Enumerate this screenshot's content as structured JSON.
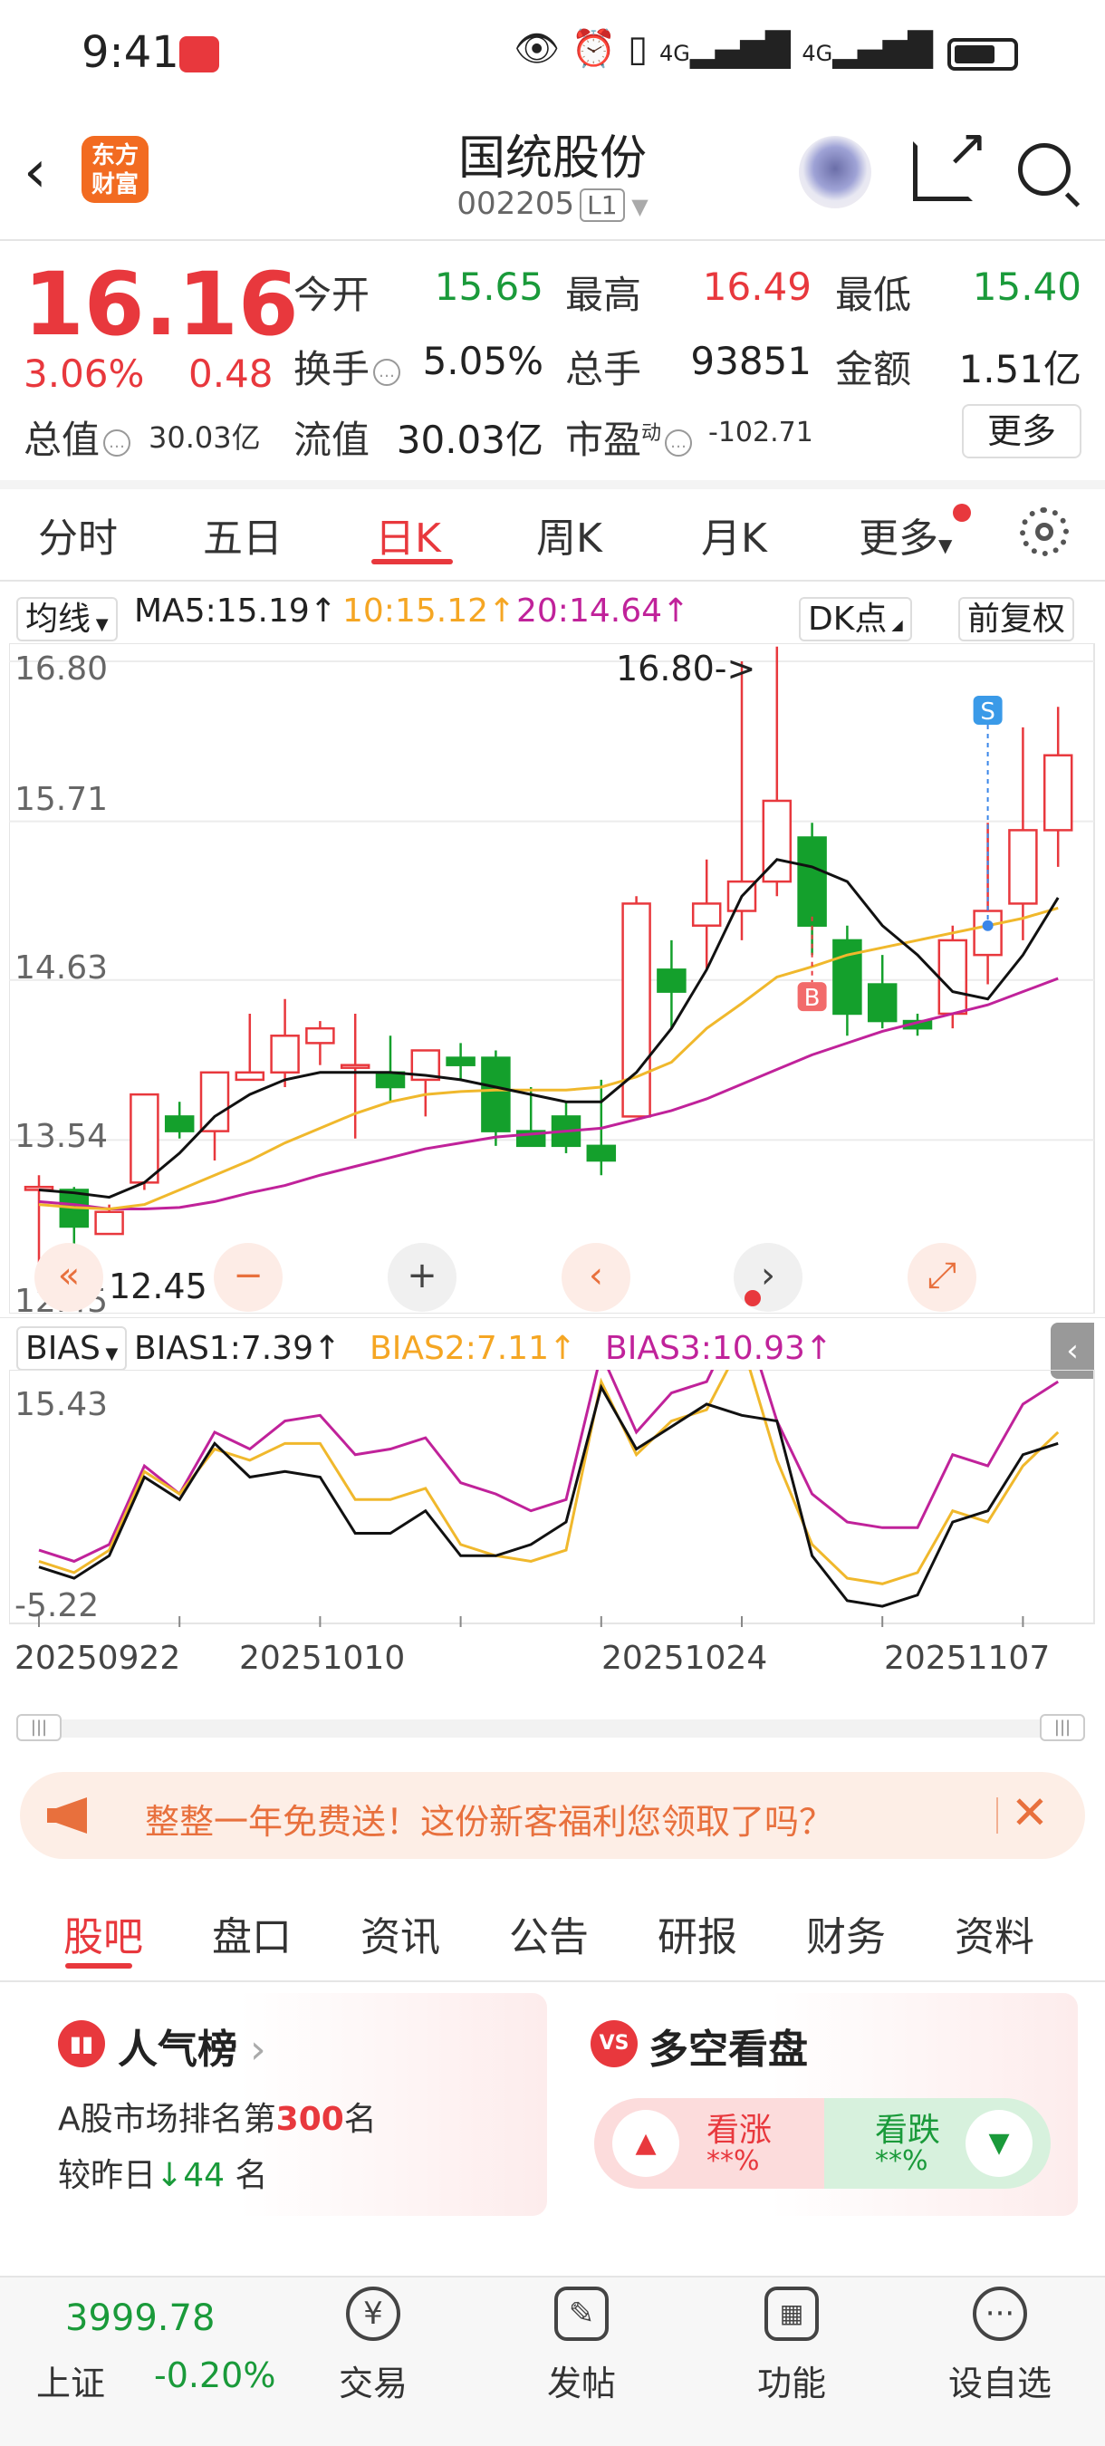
{
  "status_bar": {
    "time": "9:41",
    "net1": "4G",
    "net2": "4G"
  },
  "header": {
    "title": "国统股份",
    "code": "002205",
    "level": "L1",
    "logo_line1": "东方",
    "logo_line2": "财富"
  },
  "quote": {
    "price": "16.16",
    "pct": "3.06%",
    "change": "0.48",
    "open_label": "今开",
    "open": "15.65",
    "high_label": "最高",
    "high": "16.49",
    "low_label": "最低",
    "low": "15.40",
    "turnover_label": "换手",
    "turnover": "5.05%",
    "volume_label": "总手",
    "volume": "93851",
    "amount_label": "金额",
    "amount": "1.51亿",
    "mcap_label": "总值",
    "mcap": "30.03亿",
    "float_label": "流值",
    "float": "30.03亿",
    "pe_label": "市盈",
    "pe_sup": "动",
    "pe": "-102.71",
    "more": "更多"
  },
  "period_tabs": [
    "分时",
    "五日",
    "日K",
    "周K",
    "月K",
    "更多"
  ],
  "ma": {
    "selector": "均线",
    "ma5": "MA5:15.19↑",
    "ma10": "10:15.12↑",
    "ma20": "20:14.64↑",
    "dk": "DK点",
    "adjust": "前复权"
  },
  "kline": {
    "y_labels": [
      "16.80",
      "15.71",
      "14.63",
      "13.54",
      "12.45"
    ],
    "high_note": "16.80->",
    "low_note": "12.45",
    "buy_marker": "B",
    "sell_marker": "S"
  },
  "bias": {
    "selector": "BIAS",
    "b1": "BIAS1:7.39↑",
    "b2": "BIAS2:7.11↑",
    "b3": "BIAS3:10.93↑",
    "y_top": "15.43",
    "y_bottom": "-5.22"
  },
  "dates": [
    "20250922",
    "20251010",
    "20251024",
    "20251107"
  ],
  "colors": {
    "up": "#e8383d",
    "down": "#14a02c",
    "ma5": "#111111",
    "ma10": "#f0b82c",
    "ma20": "#c0229a",
    "accent": "#e8383d"
  },
  "chart_data": {
    "type": "candlestick",
    "candles": [
      {
        "o": 13.2,
        "h": 13.3,
        "l": 12.6,
        "c": 13.22
      },
      {
        "o": 13.2,
        "h": 13.22,
        "l": 12.45,
        "c": 12.95
      },
      {
        "o": 12.9,
        "h": 13.1,
        "l": 12.9,
        "c": 13.05
      },
      {
        "o": 13.25,
        "h": 13.85,
        "l": 13.2,
        "c": 13.85
      },
      {
        "o": 13.7,
        "h": 13.8,
        "l": 13.55,
        "c": 13.6
      },
      {
        "o": 13.6,
        "h": 14.0,
        "l": 13.4,
        "c": 14.0
      },
      {
        "o": 13.95,
        "h": 14.4,
        "l": 13.95,
        "c": 14.0
      },
      {
        "o": 14.0,
        "h": 14.5,
        "l": 13.9,
        "c": 14.25
      },
      {
        "o": 14.2,
        "h": 14.35,
        "l": 14.05,
        "c": 14.3
      },
      {
        "o": 14.05,
        "h": 14.4,
        "l": 13.55,
        "c": 14.05
      },
      {
        "o": 14.0,
        "h": 14.25,
        "l": 13.8,
        "c": 13.9
      },
      {
        "o": 13.95,
        "h": 14.15,
        "l": 13.7,
        "c": 14.15
      },
      {
        "o": 14.1,
        "h": 14.2,
        "l": 13.95,
        "c": 14.05
      },
      {
        "o": 14.1,
        "h": 14.15,
        "l": 13.5,
        "c": 13.6
      },
      {
        "o": 13.6,
        "h": 13.9,
        "l": 13.5,
        "c": 13.5
      },
      {
        "o": 13.7,
        "h": 13.8,
        "l": 13.45,
        "c": 13.5
      },
      {
        "o": 13.5,
        "h": 13.95,
        "l": 13.3,
        "c": 13.4
      },
      {
        "o": 13.7,
        "h": 15.2,
        "l": 13.7,
        "c": 15.15
      },
      {
        "o": 14.7,
        "h": 14.9,
        "l": 14.3,
        "c": 14.55
      },
      {
        "o": 15.0,
        "h": 15.45,
        "l": 14.7,
        "c": 15.15
      },
      {
        "o": 15.1,
        "h": 16.8,
        "l": 14.9,
        "c": 15.3
      },
      {
        "o": 15.3,
        "h": 16.9,
        "l": 15.2,
        "c": 15.85
      },
      {
        "o": 15.6,
        "h": 15.7,
        "l": 14.8,
        "c": 15.0
      },
      {
        "o": 14.9,
        "h": 15.0,
        "l": 14.25,
        "c": 14.4
      },
      {
        "o": 14.6,
        "h": 14.8,
        "l": 14.3,
        "c": 14.35
      },
      {
        "o": 14.35,
        "h": 14.4,
        "l": 14.25,
        "c": 14.3
      },
      {
        "o": 14.4,
        "h": 15.0,
        "l": 14.3,
        "c": 14.9
      },
      {
        "o": 14.8,
        "h": 15.7,
        "l": 14.6,
        "c": 15.1
      },
      {
        "o": 15.15,
        "h": 16.35,
        "l": 14.9,
        "c": 15.65
      },
      {
        "o": 15.65,
        "h": 16.49,
        "l": 15.4,
        "c": 16.16
      }
    ],
    "ma5": [
      13.2,
      13.18,
      13.15,
      13.25,
      13.45,
      13.7,
      13.85,
      13.95,
      14.0,
      14.0,
      14.0,
      13.98,
      13.95,
      13.9,
      13.85,
      13.8,
      13.8,
      14.0,
      14.3,
      14.7,
      15.2,
      15.45,
      15.4,
      15.3,
      15.0,
      14.8,
      14.55,
      14.5,
      14.8,
      15.19
    ],
    "ma10": [
      13.1,
      13.08,
      13.07,
      13.1,
      13.2,
      13.3,
      13.4,
      13.52,
      13.62,
      13.72,
      13.8,
      13.85,
      13.87,
      13.88,
      13.88,
      13.88,
      13.9,
      13.97,
      14.07,
      14.3,
      14.47,
      14.65,
      14.72,
      14.8,
      14.85,
      14.9,
      14.95,
      15.0,
      15.05,
      15.12
    ],
    "ma20": [
      13.12,
      13.1,
      13.07,
      13.07,
      13.08,
      13.12,
      13.18,
      13.23,
      13.3,
      13.36,
      13.42,
      13.48,
      13.52,
      13.56,
      13.58,
      13.6,
      13.62,
      13.68,
      13.74,
      13.82,
      13.92,
      14.02,
      14.12,
      14.2,
      14.28,
      14.34,
      14.4,
      14.46,
      14.55,
      14.64
    ],
    "bias1": [
      -1.0,
      -2.0,
      0.0,
      7.0,
      5.0,
      10.0,
      7.0,
      7.5,
      7.0,
      2.0,
      2.0,
      4.0,
      0.0,
      0.0,
      1.0,
      3.0,
      15.0,
      9.5,
      11.5,
      13.5,
      12.5,
      12.0,
      0.0,
      -4.0,
      -4.5,
      -3.5,
      3.0,
      4.0,
      9.0,
      10.0
    ],
    "bias2": [
      -0.5,
      -1.5,
      0.5,
      7.5,
      5.5,
      9.5,
      8.5,
      10.0,
      10.0,
      5.0,
      5.0,
      6.0,
      1.0,
      0.0,
      -0.5,
      0.5,
      15.5,
      9.0,
      12.0,
      13.0,
      19.0,
      8.5,
      1.0,
      -2.0,
      -2.5,
      -1.5,
      4.0,
      3.0,
      8.0,
      11.0
    ],
    "bias3": [
      0.5,
      -0.5,
      1.0,
      8.0,
      5.5,
      11.0,
      9.5,
      12.0,
      12.5,
      9.0,
      9.5,
      10.5,
      6.5,
      5.5,
      4.0,
      5.0,
      18.0,
      11.0,
      14.5,
      15.5,
      22.0,
      12.0,
      5.5,
      3.0,
      2.5,
      2.5,
      9.0,
      8.0,
      13.5,
      15.5
    ],
    "ylim": [
      12.45,
      16.8
    ],
    "bias_ylim": [
      -5.22,
      15.43
    ]
  },
  "banner": {
    "text": "整整一年免费送！这份新客福利您领取了吗？"
  },
  "bottom_tabs": [
    "股吧",
    "盘口",
    "资讯",
    "公告",
    "研报",
    "财务",
    "资料"
  ],
  "popularity": {
    "title": "人气榜",
    "line1_pre": "A股市场排名第",
    "rank": "300",
    "line1_post": "名",
    "line2_pre": "较昨日",
    "change": "44",
    "line2_post": "名"
  },
  "longshort": {
    "title": "多空看盘",
    "icon": "VS",
    "bull": "看涨",
    "bull_pct": "**%",
    "bear": "看跌",
    "bear_pct": "**%"
  },
  "nav": {
    "index_value": "3999.78",
    "index_name": "上证",
    "index_change": "-0.20%",
    "items": [
      "交易",
      "发帖",
      "功能",
      "设自选"
    ]
  }
}
